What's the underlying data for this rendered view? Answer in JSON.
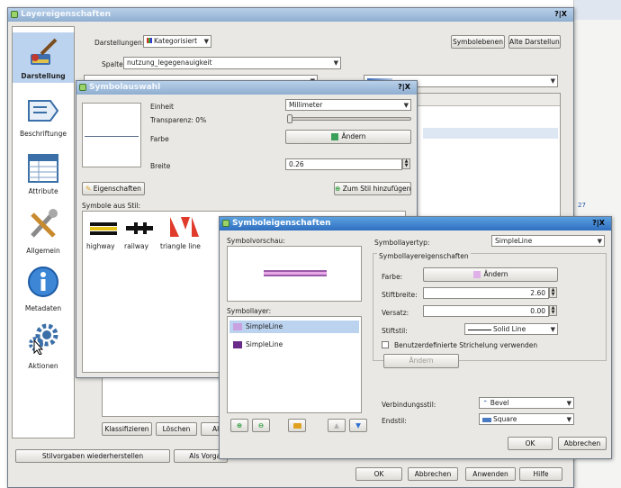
{
  "main": {
    "title": "Layereigenschaften",
    "close": "?|X",
    "sidebar": [
      "Darstellung",
      "Beschriftunge",
      "Attribute",
      "Allgemein",
      "Metadaten",
      "Aktionen"
    ],
    "darstellungen_label": "Darstellungen:",
    "darstellungen_value": "Kategorisiert",
    "symbolebenen": "Symbolebenen",
    "alte_darstellung": "Alte Darstellung",
    "spalte_label": "Spalte:",
    "spalte_value": "nutzung_legegenauigkeit",
    "klassifizieren": "Klassifizieren",
    "loeschen": "Löschen",
    "al": "Al",
    "stilvorgaben": "Stilvorgaben wiederherstellen",
    "als_vorgabe": "Als Vorgab",
    "ok": "OK",
    "abbrechen": "Abbrechen",
    "anwenden": "Anwenden",
    "hilfe": "Hilfe",
    "side_number": "27"
  },
  "symbolauswahl": {
    "title": "Symbolauswahl",
    "close": "?|X",
    "einheit_label": "Einheit",
    "einheit_value": "Millimeter",
    "transparenz_label": "Transparenz: 0%",
    "farbe_label": "Farbe",
    "farbe_button": "Ändern",
    "breite_label": "Breite",
    "breite_value": "0.26",
    "eigenschaften": "Eigenschaften",
    "zum_stil": "Zum Stil hinzufügen",
    "symbole_label": "Symbole aus Stil:",
    "symbols": [
      "highway",
      "railway",
      "triangle line"
    ]
  },
  "symboleigenschaften": {
    "title": "Symboleigenschaften",
    "close": "?|X",
    "vorschau_label": "Symbolvorschau:",
    "symbolebenen_label": "Symbollayer:",
    "layers": [
      "SimpleLine",
      "SimpleLine"
    ],
    "layertyp_label": "Symbollayertyp:",
    "layertyp_value": "SimpleLine",
    "group_label": "Symbollayereigenschaften",
    "farbe_label": "Farbe:",
    "farbe_button": "Ändern",
    "stiftbreite_label": "Stiftbreite:",
    "stiftbreite_value": "2.60",
    "versatz_label": "Versatz:",
    "versatz_value": "0.00",
    "stil_label": "Stiftstil:",
    "stil_value": "Solid Line",
    "benutzer_label": "Benutzerdefinierte Strichelung verwenden",
    "aendern": "Ändern",
    "verbindung_label": "Verbindungsstil:",
    "verbindung_value": "Bevel",
    "endstil_label": "Endstil:",
    "endstil_value": "Square",
    "ok": "OK",
    "abbrechen": "Abbrechen"
  }
}
